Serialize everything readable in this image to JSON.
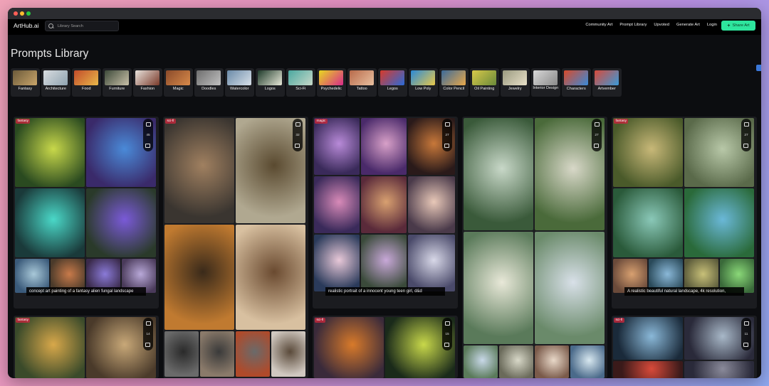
{
  "app": {
    "brand": "ArtHub.ai",
    "search_placeholder": "Library Search",
    "nav_links": [
      "Community Art",
      "Prompt Library",
      "Upvoted",
      "Generate Art",
      "Login"
    ],
    "share_label": "Share Art",
    "accent_color": "#2ee59d"
  },
  "page_title": "Prompts Library",
  "categories": [
    {
      "label": "Fantasy",
      "colors": [
        "#6b5a3a",
        "#c9a56a"
      ]
    },
    {
      "label": "Architecture",
      "colors": [
        "#d9dde0",
        "#8fa3b0"
      ]
    },
    {
      "label": "Food",
      "colors": [
        "#c24b2a",
        "#e8b84a"
      ]
    },
    {
      "label": "Furniture",
      "colors": [
        "#3d4a3a",
        "#c8c0a8"
      ]
    },
    {
      "label": "Fashion",
      "colors": [
        "#e8e2dc",
        "#7a3a2a"
      ]
    },
    {
      "label": "Magic",
      "colors": [
        "#8a4a2a",
        "#d88a4a"
      ]
    },
    {
      "label": "Doodles",
      "colors": [
        "#6e6e6e",
        "#c0c0c0"
      ]
    },
    {
      "label": "Watercolor",
      "colors": [
        "#6a8aa8",
        "#d8e0e8"
      ]
    },
    {
      "label": "Logos",
      "colors": [
        "#1e3a2a",
        "#e8e8d8"
      ]
    },
    {
      "label": "Sci-Fi",
      "colors": [
        "#4aa8a0",
        "#c8d8c8"
      ]
    },
    {
      "label": "Psychedelic",
      "colors": [
        "#e8d820",
        "#d82a8a"
      ]
    },
    {
      "label": "Tattoo",
      "colors": [
        "#b86a4a",
        "#e8c0a0"
      ]
    },
    {
      "label": "Legos",
      "colors": [
        "#d83a2a",
        "#2a6ad8"
      ]
    },
    {
      "label": "Low Poly",
      "colors": [
        "#2a8ad8",
        "#e8c84a"
      ]
    },
    {
      "label": "Color Pencil",
      "colors": [
        "#3a6a9a",
        "#e8a84a"
      ]
    },
    {
      "label": "Oil Painting",
      "colors": [
        "#d8c84a",
        "#6a8a3a"
      ]
    },
    {
      "label": "Jewelry",
      "colors": [
        "#9a9a80",
        "#e8e0c8"
      ]
    },
    {
      "label": "Interior Design",
      "colors": [
        "#d8d8d8",
        "#8a8a8a"
      ]
    },
    {
      "label": "Characters",
      "colors": [
        "#d84a2a",
        "#3a8ad8"
      ]
    },
    {
      "label": "Artvember",
      "colors": [
        "#d84a3a",
        "#3a9ad8"
      ]
    }
  ],
  "cards": [
    {
      "tag": "fantasy",
      "votes": "45",
      "caption": "concept art painting of a fantasy alien fungal landscape"
    },
    {
      "tag": "sci-fi",
      "votes": "32",
      "caption": ""
    },
    {
      "tag": "magic",
      "votes": "27",
      "caption": "realistic portrait of a innocent young teen girl, d&d"
    },
    {
      "tag": "",
      "votes": "27",
      "caption": ""
    },
    {
      "tag": "fantasy",
      "votes": "27",
      "caption": "A realistic beautiful natural landscape, 4k resolution,"
    },
    {
      "tag": "fantasy",
      "votes": "14",
      "caption": ""
    },
    {
      "tag": "sci-fi",
      "votes": "15",
      "caption": ""
    },
    {
      "tag": "sci-fi",
      "votes": "11",
      "caption": ""
    }
  ]
}
